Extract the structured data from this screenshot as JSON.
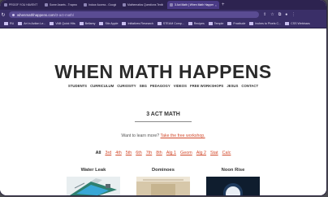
{
  "browser": {
    "tabs": [
      {
        "title": "PROOF YOU HAVEN'T HUMP I TALK",
        "active": false
      },
      {
        "title": "Some Assets - Trapezoids",
        "active": false
      },
      {
        "title": "Indoor Access - Google",
        "active": false
      },
      {
        "title": "Mathematics Questions Textbook",
        "active": false
      },
      {
        "title": "3 Act Math | When Math Happens",
        "active": true
      }
    ],
    "new_tab": "+",
    "url_host": "whenmathhappens.com",
    "url_path": "/3-act-math/",
    "bookmarks": [
      "RU",
      "Art in Action Le...",
      "VAB Quick Hits",
      "Bellamy",
      "Stix Apple",
      "Initiatives Research",
      "STEAM Comp...",
      "Recipes",
      "Temple",
      "Fraxitude",
      "Inches to Pixels C...",
      "CSS Webinars"
    ]
  },
  "site": {
    "title": "WHEN MATH HAPPENS",
    "menu": [
      "STUDENTS",
      "CURRICULUM",
      "CURIOSITY",
      "SBG",
      "PEDAGOGY",
      "VIDEOS",
      "FREE WORKSHOPS",
      "JESUS",
      "CONTACT"
    ]
  },
  "main": {
    "section_title": "3 ACT MATH",
    "learn_prefix": "Want to learn more? ",
    "learn_link": "Take the free workshop.",
    "filters": [
      "All",
      "3rd",
      "4th",
      "5th",
      "6th",
      "7th",
      "8th",
      "Alg 1",
      "Geom",
      "Alg 2",
      "Stat",
      "Calc"
    ],
    "active_filter": "All",
    "cards": [
      {
        "title": "Water Leak",
        "image": "isometric-pool-illustration"
      },
      {
        "title": "Dominoes",
        "image": "dominoes-photo"
      },
      {
        "title": "Noon Rise",
        "image": "moon-photo"
      }
    ]
  },
  "colors": {
    "chrome": "#3a2f68",
    "tab_strip": "#2d2350",
    "link": "#d24a2c"
  }
}
